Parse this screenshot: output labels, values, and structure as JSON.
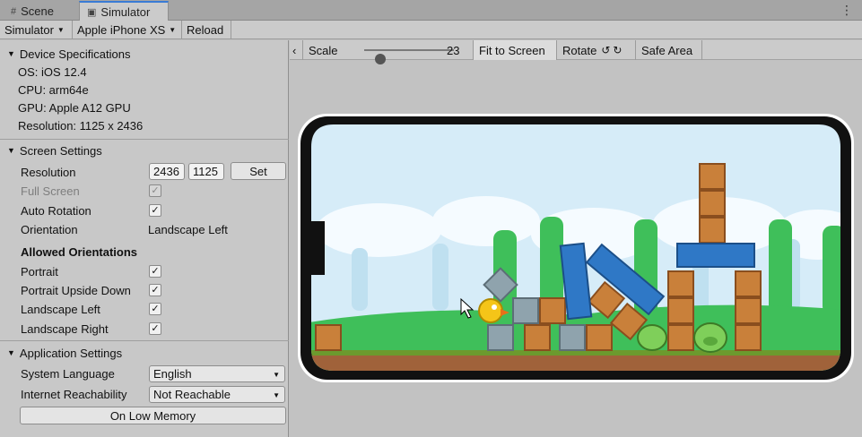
{
  "tabs": [
    {
      "label": "Scene",
      "icon": "grid-icon"
    },
    {
      "label": "Simulator",
      "icon": "device-icon"
    }
  ],
  "toolbar": {
    "mode": "Simulator",
    "device": "Apple iPhone XS",
    "reload": "Reload"
  },
  "device_specs": {
    "header": "Device Specifications",
    "os": "OS: iOS 12.4",
    "cpu": "CPU: arm64e",
    "gpu": "GPU: Apple A12 GPU",
    "resolution": "Resolution: 1125 x 2436"
  },
  "screen_settings": {
    "header": "Screen Settings",
    "resolution_label": "Resolution",
    "res_width": "2436",
    "res_height": "1125",
    "set_label": "Set",
    "full_screen_label": "Full Screen",
    "full_screen_checked": true,
    "auto_rotation_label": "Auto Rotation",
    "auto_rotation_checked": true,
    "orientation_label": "Orientation",
    "orientation_value": "Landscape Left",
    "allowed_orientations_label": "Allowed Orientations",
    "portrait_label": "Portrait",
    "portrait_upside_down_label": "Portrait Upside Down",
    "landscape_left_label": "Landscape Left",
    "landscape_right_label": "Landscape Right",
    "check_glyph": "✓"
  },
  "app_settings": {
    "header": "Application Settings",
    "system_language_label": "System Language",
    "system_language_value": "English",
    "internet_label": "Internet Reachability",
    "internet_value": "Not Reachable",
    "low_memory_label": "On Low Memory"
  },
  "sim_toolbar": {
    "scale_label": "Scale",
    "scale_value": "23",
    "scale_fraction": 0.18,
    "fit_label": "Fit to Screen",
    "rotate_label": "Rotate",
    "safe_area_label": "Safe Area"
  },
  "colors": {
    "accent_tab": "#3a7bd5",
    "sky": "#d4ecf8",
    "grass": "#3fbf5a",
    "dirt": "#a0623a",
    "crate": "#c9803a",
    "blue_block": "#2f78c6"
  }
}
